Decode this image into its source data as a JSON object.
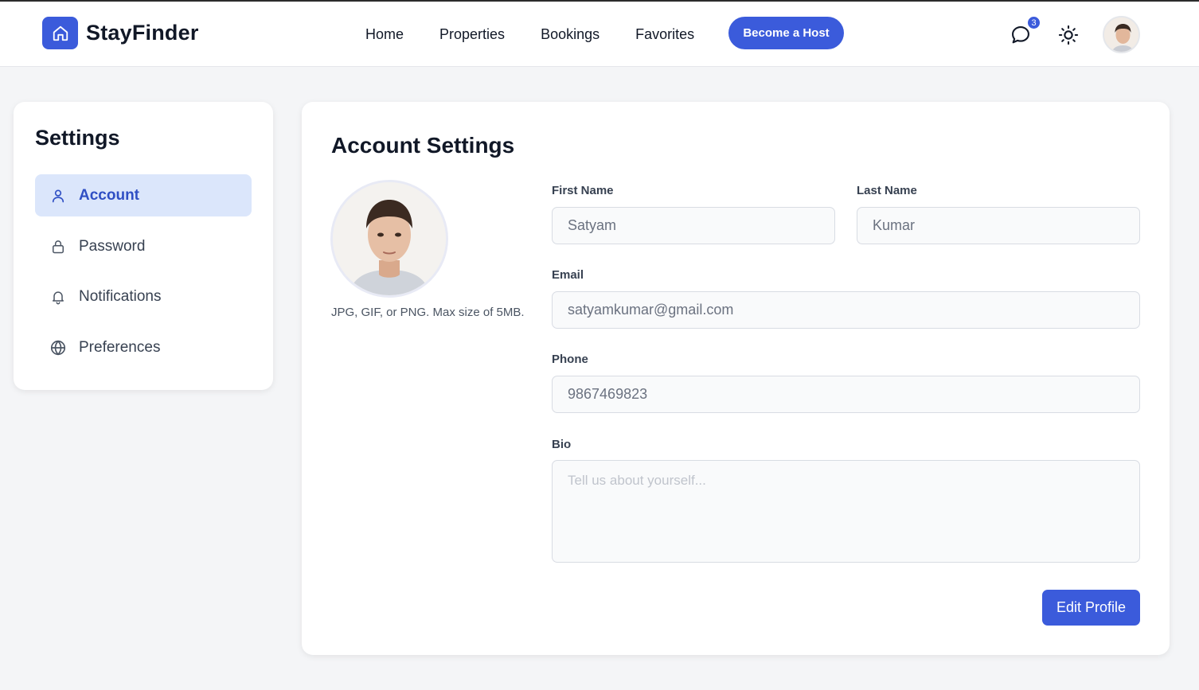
{
  "brand": {
    "name": "StayFinder",
    "logo_icon": "home-icon",
    "color": "#3b5bdb"
  },
  "nav": {
    "links": [
      "Home",
      "Properties",
      "Bookings",
      "Favorites"
    ],
    "host_button": "Become a Host",
    "messages_badge": "3"
  },
  "sidebar": {
    "title": "Settings",
    "items": [
      {
        "label": "Account",
        "icon": "user-icon",
        "active": true
      },
      {
        "label": "Password",
        "icon": "lock-icon",
        "active": false
      },
      {
        "label": "Notifications",
        "icon": "bell-icon",
        "active": false
      },
      {
        "label": "Preferences",
        "icon": "globe-icon",
        "active": false
      }
    ]
  },
  "account": {
    "title": "Account Settings",
    "photo_hint": "JPG, GIF, or PNG. Max size of 5MB.",
    "first_name_label": "First Name",
    "first_name_value": "Satyam",
    "last_name_label": "Last Name",
    "last_name_value": "Kumar",
    "email_label": "Email",
    "email_value": "satyamkumar@gmail.com",
    "phone_label": "Phone",
    "phone_value": "9867469823",
    "bio_label": "Bio",
    "bio_placeholder": "Tell us about yourself...",
    "edit_button": "Edit Profile"
  }
}
